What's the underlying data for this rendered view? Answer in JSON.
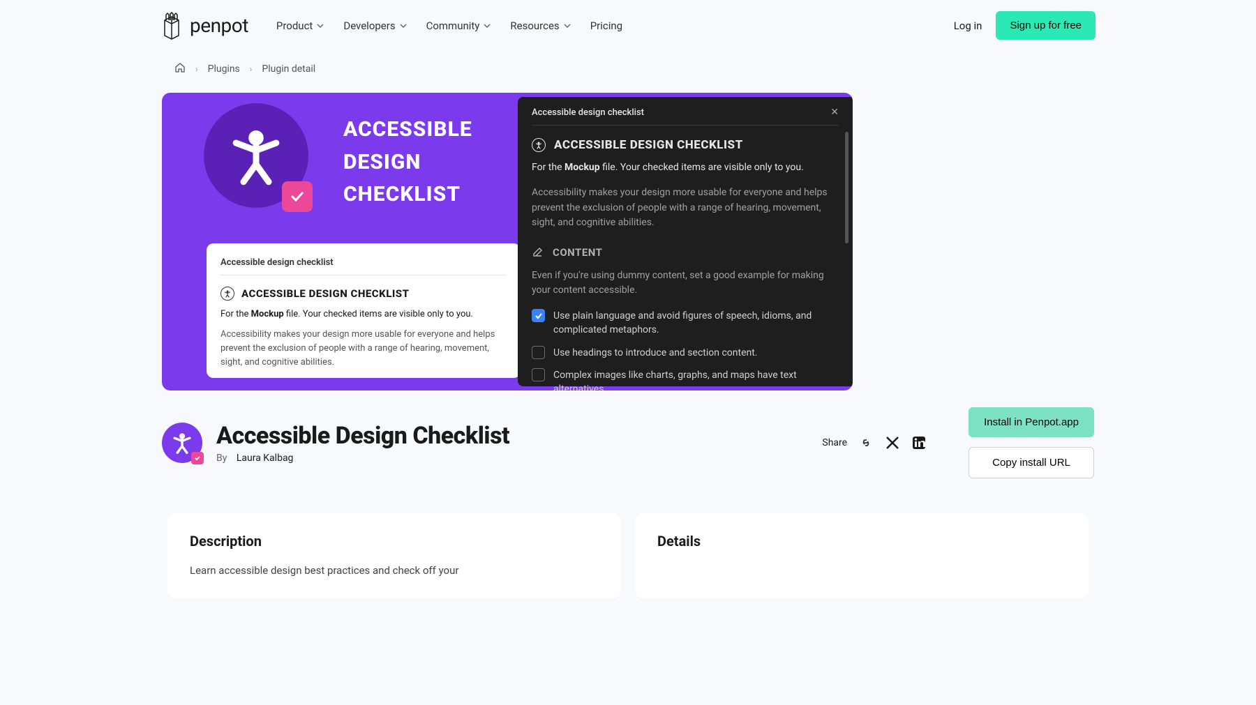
{
  "brand": "penpot",
  "nav": {
    "items": [
      "Product",
      "Developers",
      "Community",
      "Resources"
    ],
    "pricing": "Pricing"
  },
  "auth": {
    "login": "Log in",
    "signup": "Sign up for free"
  },
  "breadcrumb": {
    "home_icon": "home",
    "plugins": "Plugins",
    "current": "Plugin detail"
  },
  "hero": {
    "title": "ACCESSIBLE DESIGN CHECKLIST",
    "light_card": {
      "tab": "Accessible design checklist",
      "head": "ACCESSIBLE DESIGN CHECKLIST",
      "sub_prefix": "For the ",
      "sub_bold": "Mockup",
      "sub_suffix": " file. Your checked items are visible only to you.",
      "desc": "Accessibility makes your design more usable for everyone and helps prevent the exclusion of people with a range of hearing, movement, sight, and cognitive abilities."
    },
    "dark_card": {
      "tab": "Accessible design checklist",
      "head": "ACCESSIBLE DESIGN CHECKLIST",
      "sub_prefix": "For the ",
      "sub_bold": "Mockup",
      "sub_suffix": " file. Your checked items are visible only to you.",
      "desc": "Accessibility makes your design more usable for everyone and helps prevent the exclusion of people with a range of hearing, movement, sight, and cognitive abilities.",
      "section": "CONTENT",
      "section_desc": "Even if you're using dummy content, set a good example for making your content accessible.",
      "items": [
        {
          "checked": true,
          "label": "Use plain language and avoid figures of speech, idioms, and complicated metaphors."
        },
        {
          "checked": false,
          "label": "Use headings to introduce and section content."
        },
        {
          "checked": false,
          "label": "Complex images like charts, graphs, and maps have text alternatives."
        }
      ]
    }
  },
  "plugin": {
    "title": "Accessible Design Checklist",
    "by_label": "By",
    "author": "Laura Kalbag",
    "share_label": "Share",
    "install": "Install in Penpot.app",
    "copy": "Copy install URL"
  },
  "panels": {
    "description": {
      "title": "Description",
      "body": "Learn accessible design best practices and check off your"
    },
    "details": {
      "title": "Details"
    }
  }
}
